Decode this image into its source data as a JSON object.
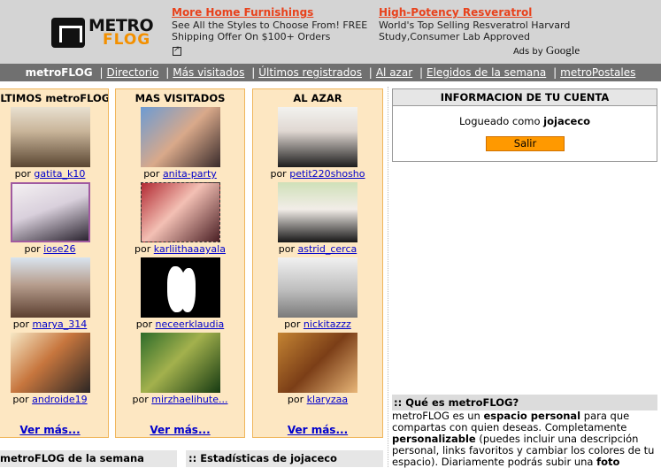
{
  "logo": {
    "word1": "METRO",
    "word2": "FLOG"
  },
  "ads": [
    {
      "title": "More Home Furnishings",
      "text": "See All the Styles to Choose From! FREE Shipping Offer On $100+ Orders"
    },
    {
      "title": "High-Potency Resveratrol",
      "text": "World's Top Selling Resveratrol Harvard Study,Consumer Lab Approved"
    }
  ],
  "adsby": {
    "prefix": "Ads by",
    "brand": "Google"
  },
  "nav": {
    "home": "metroFLOG",
    "links": [
      "Directorio",
      "Más visitados",
      "Últimos registrados",
      "Al azar",
      "Elegidos de la semana",
      "metroPostales"
    ]
  },
  "columns": [
    {
      "title": "ULTIMOS metroFLOGS",
      "entries": [
        {
          "prefix": "por",
          "user": "gatita_k10"
        },
        {
          "prefix": "por",
          "user": "iose26"
        },
        {
          "prefix": "por",
          "user": "marya_314"
        },
        {
          "prefix": "por",
          "user": "androide19"
        }
      ],
      "more": "Ver más..."
    },
    {
      "title": "MAS VISITADOS",
      "entries": [
        {
          "prefix": "por",
          "user": "anita-party"
        },
        {
          "prefix": "por",
          "user": "karliithaaayala"
        },
        {
          "prefix": "por",
          "user": "neceerklaudia"
        },
        {
          "prefix": "por",
          "user": "mirzhaelihute..."
        }
      ],
      "more": "Ver más..."
    },
    {
      "title": "AL AZAR",
      "entries": [
        {
          "prefix": "por",
          "user": "petit220shosho"
        },
        {
          "prefix": "por",
          "user": "astrid_cerca"
        },
        {
          "prefix": "por",
          "user": "nickitazzz"
        },
        {
          "prefix": "por",
          "user": "klaryzaa"
        }
      ],
      "more": "Ver más..."
    }
  ],
  "account": {
    "title": "INFORMACION DE TU CUENTA",
    "logged_prefix": "Logueado como",
    "username": "jojaceco",
    "logout": "Salir"
  },
  "about": {
    "title": ":: Qué es metroFLOG?",
    "p1": "metroFLOG es un",
    "b1": "espacio personal",
    "p2": "para que compartas con quien deseas. Completamente",
    "b2": "personalizable",
    "p3": "(puedes incluir una descripción personal, links favoritos y cambiar los colores de tu espacio). Diariamente podrás subir una",
    "b3": "foto"
  },
  "bottom": {
    "left_title": "metroFLOG de la semana",
    "right_title": ":: Estadísticas de jojaceco"
  },
  "colors": {
    "accent": "#ff9900",
    "column_bg": "#fde7c2",
    "column_border": "#f0b65c",
    "nav_bg": "#707070",
    "ad_title": "#e8421c"
  }
}
